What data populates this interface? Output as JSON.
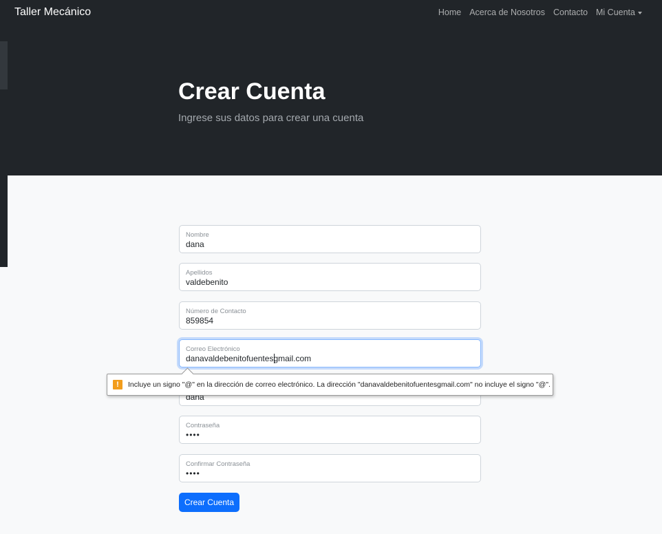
{
  "navbar": {
    "brand": "Taller Mecánico",
    "links": [
      "Home",
      "Acerca de Nosotros",
      "Contacto",
      "Mi Cuenta"
    ]
  },
  "header": {
    "title": "Crear Cuenta",
    "subtitle": "Ingrese sus datos para crear una cuenta"
  },
  "form": {
    "nombre": {
      "label": "Nombre",
      "value": "dana"
    },
    "apellidos": {
      "label": "Apellidos",
      "value": "valdebenito"
    },
    "contacto": {
      "label": "Número de Contacto",
      "value": "859854"
    },
    "correo": {
      "label": "Correo Electrónico",
      "value": "danavaldebenitofuentesgmail.com"
    },
    "usuario": {
      "label": "",
      "value": "dana"
    },
    "password": {
      "label": "Contraseña",
      "value": "••••"
    },
    "confirm": {
      "label": "Confirmar Contraseña",
      "value": "••••"
    },
    "submit_label": "Crear Cuenta"
  },
  "validation": {
    "message": "Incluye un signo \"@\" en la dirección de correo electrónico. La dirección \"danavaldebenitofuentesgmail.com\" no incluye el signo \"@\".",
    "icon": "warning-icon",
    "icon_glyph": "!"
  },
  "colors": {
    "dark": "#212529",
    "primary": "#0d6efd",
    "warning": "#f29d1c"
  }
}
